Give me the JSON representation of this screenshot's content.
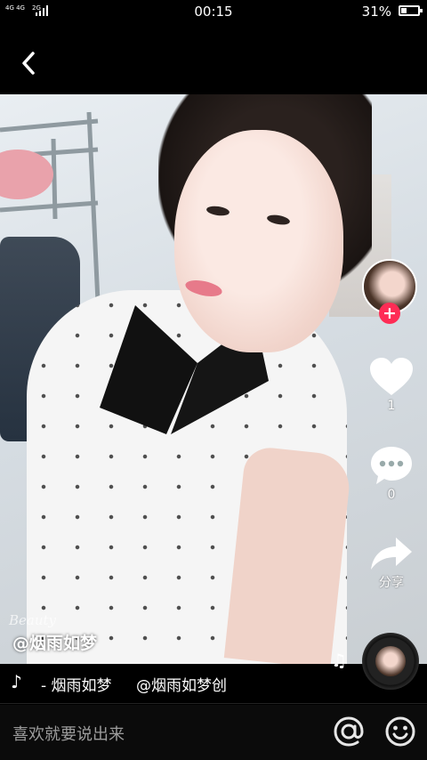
{
  "status_bar": {
    "network": "4G 4G",
    "network_sub": "2G",
    "time": "00:15",
    "battery_percent": "31%",
    "battery_level": 0.31
  },
  "video": {
    "watermark": "Beauty",
    "author_handle": "@烟雨如梦"
  },
  "sidebar": {
    "like_count": "1",
    "comment_count": "0",
    "share_label": "分享",
    "follow_symbol": "+"
  },
  "music": {
    "title": "- 烟雨如梦",
    "creator": "@烟雨如梦创"
  },
  "comment_box": {
    "placeholder": "喜欢就要说出来"
  },
  "icons": {
    "back": "chevron-left-icon",
    "like": "heart-icon",
    "comment": "chat-bubble-icon",
    "share": "share-arrow-icon",
    "music": "music-note-icon",
    "mention": "at-sign-icon",
    "emoji": "smiley-icon"
  },
  "colors": {
    "follow_badge": "#fe2c55",
    "background": "#000000"
  }
}
